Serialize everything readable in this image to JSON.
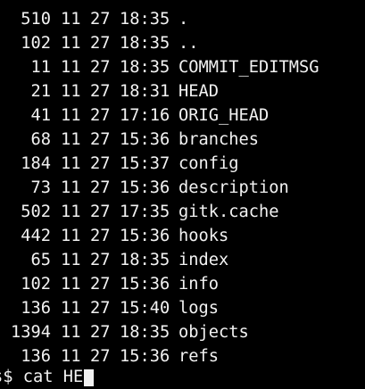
{
  "terminal": {
    "rows": [
      {
        "size": "510",
        "month": "11",
        "day": "27",
        "time": "18:35",
        "name": "."
      },
      {
        "size": "102",
        "month": "11",
        "day": "27",
        "time": "18:35",
        "name": ".."
      },
      {
        "size": "11",
        "month": "11",
        "day": "27",
        "time": "18:35",
        "name": "COMMIT_EDITMSG"
      },
      {
        "size": "21",
        "month": "11",
        "day": "27",
        "time": "18:31",
        "name": "HEAD"
      },
      {
        "size": "41",
        "month": "11",
        "day": "27",
        "time": "17:16",
        "name": "ORIG_HEAD"
      },
      {
        "size": "68",
        "month": "11",
        "day": "27",
        "time": "15:36",
        "name": "branches"
      },
      {
        "size": "184",
        "month": "11",
        "day": "27",
        "time": "15:37",
        "name": "config"
      },
      {
        "size": "73",
        "month": "11",
        "day": "27",
        "time": "15:36",
        "name": "description"
      },
      {
        "size": "502",
        "month": "11",
        "day": "27",
        "time": "17:35",
        "name": "gitk.cache"
      },
      {
        "size": "442",
        "month": "11",
        "day": "27",
        "time": "15:36",
        "name": "hooks"
      },
      {
        "size": "65",
        "month": "11",
        "day": "27",
        "time": "18:35",
        "name": "index"
      },
      {
        "size": "102",
        "month": "11",
        "day": "27",
        "time": "15:36",
        "name": "info"
      },
      {
        "size": "136",
        "month": "11",
        "day": "27",
        "time": "15:40",
        "name": "logs"
      },
      {
        "size": "1394",
        "month": "11",
        "day": "27",
        "time": "18:35",
        "name": "objects"
      },
      {
        "size": "136",
        "month": "11",
        "day": "27",
        "time": "15:36",
        "name": "refs"
      }
    ],
    "prompt": {
      "text": "s$ cat HE"
    }
  }
}
